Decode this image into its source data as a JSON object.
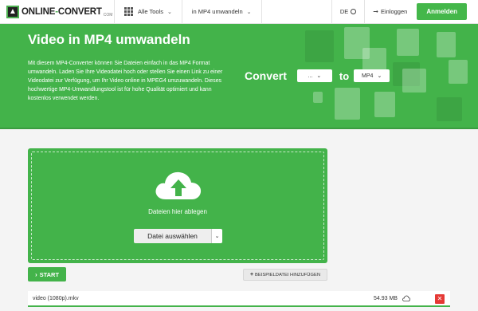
{
  "nav": {
    "logo_text_1": "ONLINE",
    "logo_text_dash": "-",
    "logo_text_2": "CONVERT",
    "logo_sub": "COM",
    "all_tools": "Alle Tools",
    "current_tool": "in MP4 umwandeln",
    "language": "DE",
    "login": "Einloggen",
    "signup": "Anmelden"
  },
  "hero": {
    "title": "Video in MP4 umwandeln",
    "description": "Mit diesem MP4-Converter können Sie Dateien einfach in das MP4 Format umwandeln. Laden Sie Ihre Videodatei hoch oder stellen Sie einen Link zu einer Videodatei zur Verfügung, um Ihr Video online in MPEG4 umzuwandeln. Dieses hochwertige MP4-Umwandlungstool ist für hohe Qualität optimiert und kann kostenlos verwendet werden.",
    "convert_label": "Convert",
    "from_value": "...",
    "to_label": "to",
    "to_value": "MP4"
  },
  "upload": {
    "drop_text": "Dateien hier ablegen",
    "choose_label": "Datei auswählen"
  },
  "actions": {
    "start_label": "START",
    "sample_label": "BEISPIELDATEI HINZUFÜGEN"
  },
  "file": {
    "name": "video (1080p).mkv",
    "size": "54.93 MB"
  },
  "colors": {
    "brand_green": "#43b34a",
    "delete_red": "#e53935"
  }
}
